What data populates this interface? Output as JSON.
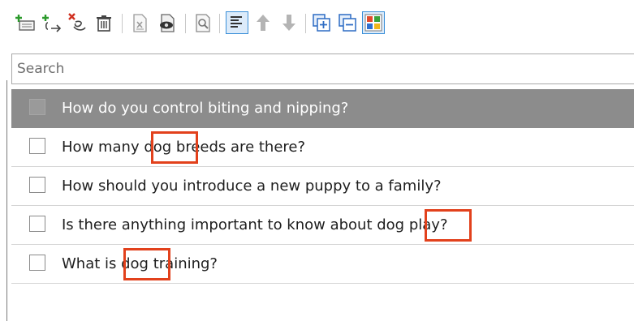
{
  "search": {
    "placeholder": "Search",
    "value": ""
  },
  "toolbar": {
    "buttons": [
      {
        "name": "add-question-button"
      },
      {
        "name": "add-follow-up-button"
      },
      {
        "name": "delete-prompt-button"
      },
      {
        "name": "delete-button"
      },
      {
        "name": "export-button"
      },
      {
        "name": "preview-button"
      },
      {
        "name": "find-button"
      },
      {
        "name": "sort-button",
        "active": true
      },
      {
        "name": "move-up-button"
      },
      {
        "name": "move-down-button"
      },
      {
        "name": "expand-all-button"
      },
      {
        "name": "collapse-all-button"
      },
      {
        "name": "view-tiles-button",
        "active": true
      }
    ]
  },
  "questions": [
    {
      "text": "How do you control biting and nipping?",
      "selected": true,
      "checked": false
    },
    {
      "text": "How many dog breeds are there?",
      "selected": false,
      "checked": false,
      "highlight": "dog"
    },
    {
      "text": "How should you introduce a new puppy to a family?",
      "selected": false,
      "checked": false
    },
    {
      "text": "Is there anything important to know about dog play?",
      "selected": false,
      "checked": false,
      "highlight": "dog"
    },
    {
      "text": "What is dog training?",
      "selected": false,
      "checked": false,
      "highlight": "dog"
    }
  ],
  "colors": {
    "selected_row": "#8c8c8c",
    "highlight_border": "#e2411c",
    "active_tool": "#3a8fd8"
  }
}
